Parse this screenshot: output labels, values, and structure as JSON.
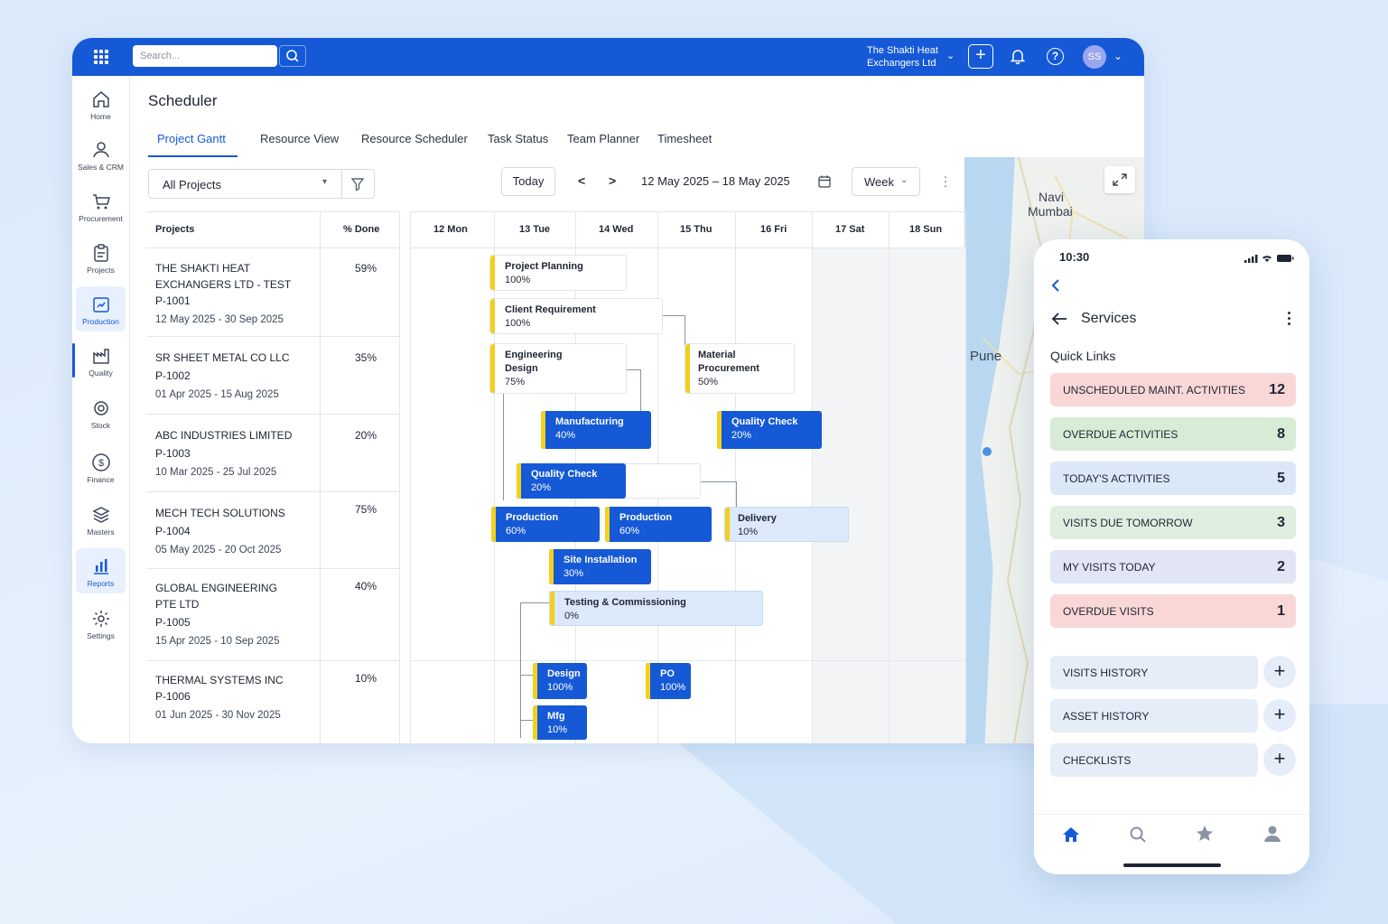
{
  "topbar": {
    "search_placeholder": "Search...",
    "company_line1": "The Shakti Heat",
    "company_line2": "Exchangers Ltd",
    "avatar": "SS"
  },
  "sidebar": {
    "items": [
      {
        "label": "Home",
        "icon": "home-icon"
      },
      {
        "label": "Sales & CRM",
        "icon": "user-icon"
      },
      {
        "label": "Procurement",
        "icon": "cart-icon"
      },
      {
        "label": "Projects",
        "icon": "clipboard-icon"
      },
      {
        "label": "Production",
        "icon": "factory-icon"
      },
      {
        "label": "Quality",
        "icon": "quality-icon"
      },
      {
        "label": "Stock",
        "icon": "stock-icon"
      },
      {
        "label": "Finance",
        "icon": "dollar-icon"
      },
      {
        "label": "Masters",
        "icon": "layers-icon"
      },
      {
        "label": "Reports",
        "icon": "chart-icon"
      },
      {
        "label": "Settings",
        "icon": "gear-icon"
      }
    ]
  },
  "page": {
    "title": "Scheduler",
    "tabs": [
      "Project Gantt",
      "Resource View",
      "Resource Scheduler",
      "Task Status",
      "Team Planner",
      "Timesheet"
    ],
    "project_filter": "All Projects",
    "today": "Today",
    "date_range": "12 May 2025 – 18 May 2025",
    "view": "Week"
  },
  "gantt": {
    "col_projects": "Projects",
    "col_done": "% Done",
    "days": [
      "12 Mon",
      "13 Tue",
      "14 Wed",
      "15 Thu",
      "16 Fri",
      "17 Sat",
      "18 Sun"
    ],
    "projects": [
      {
        "name1": "THE SHAKTI HEAT",
        "name2": "EXCHANGERS LTD - TEST",
        "code": "P-1001",
        "dates": "12 May 2025 - 30 Sep 2025",
        "done": "59%"
      },
      {
        "name1": "SR SHEET METAL CO LLC",
        "name2": "",
        "code": "P-1002",
        "dates": "01 Apr 2025 - 15 Aug 2025",
        "done": "35%"
      },
      {
        "name1": "ABC INDUSTRIES LIMITED",
        "name2": "",
        "code": "P-1003",
        "dates": "10 Mar 2025 - 25 Jul 2025",
        "done": "20%"
      },
      {
        "name1": "MECH TECH SOLUTIONS",
        "name2": "",
        "code": "P-1004",
        "dates": "05 May 2025 - 20 Oct 2025",
        "done": "75%"
      },
      {
        "name1": "GLOBAL ENGINEERING",
        "name2": "PTE LTD",
        "code": "P-1005",
        "dates": "15 Apr 2025 - 10 Sep 2025",
        "done": "40%"
      },
      {
        "name1": "THERMAL SYSTEMS INC",
        "name2": "",
        "code": "P-1006",
        "dates": "01 Jun 2025 - 30 Nov 2025",
        "done": "10%"
      }
    ],
    "tasks": [
      {
        "name": "Project Planning",
        "pct": "100%"
      },
      {
        "name": "Client Requirement",
        "pct": "100%"
      },
      {
        "name": "Engineering",
        "name2": "Design",
        "pct": "75%"
      },
      {
        "name": "Material",
        "name2": "Procurement",
        "pct": "50%"
      },
      {
        "name": "Manufacturing",
        "pct": "40%"
      },
      {
        "name": "Quality Check",
        "pct": "20%"
      },
      {
        "name": "Quality Check",
        "pct": "20%"
      },
      {
        "name": "Production",
        "pct": "60%"
      },
      {
        "name": "Production",
        "pct": "60%"
      },
      {
        "name": "Delivery",
        "pct": "10%"
      },
      {
        "name": "Site Installation",
        "pct": "30%"
      },
      {
        "name": "Testing & Commissioning",
        "pct": "0%"
      },
      {
        "name": "Design",
        "pct": "100%"
      },
      {
        "name": "PO",
        "pct": "100%"
      },
      {
        "name": "Mfg",
        "pct": "10%"
      }
    ]
  },
  "map": {
    "label_navi1": "Navi",
    "label_navi2": "Mumbai",
    "label_pune": "Pune"
  },
  "phone": {
    "time": "10:30",
    "title": "Services",
    "quick_links": "Quick Links",
    "links": [
      {
        "label": "UNSCHEDULED MAINT. ACTIVITIES",
        "count": "12",
        "color": "#f9d7d7"
      },
      {
        "label": "OVERDUE ACTIVITIES",
        "count": "8",
        "color": "#d6ecd6"
      },
      {
        "label": "TODAY'S ACTIVITIES",
        "count": "5",
        "color": "#dbe8f8"
      },
      {
        "label": "VISITS DUE TOMORROW",
        "count": "3",
        "color": "#dfeee0"
      },
      {
        "label": "MY VISITS TODAY",
        "count": "2",
        "color": "#e2e5f6"
      },
      {
        "label": "OVERDUE VISITS",
        "count": "1",
        "color": "#f9d7d7"
      }
    ],
    "history": [
      "VISITS HISTORY",
      "ASSET HISTORY",
      "CHECKLISTS"
    ]
  }
}
